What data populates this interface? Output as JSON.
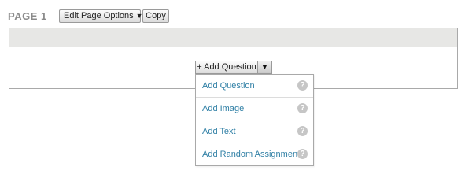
{
  "page": {
    "label": "PAGE 1",
    "edit_options_label": "Edit Page Options",
    "edit_options_caret": "▼",
    "copy_label": "Copy"
  },
  "add_question": {
    "label": "+ Add Question",
    "toggle_caret": "▼"
  },
  "menu": {
    "items": [
      {
        "label": "Add Question",
        "help": "?"
      },
      {
        "label": "Add Image",
        "help": "?"
      },
      {
        "label": "Add Text",
        "help": "?"
      },
      {
        "label": "Add Random Assignment",
        "help": "?"
      }
    ]
  },
  "colors": {
    "link": "#2f7fa5",
    "page_label": "#8a8a8a",
    "header_band": "#e7e7e5",
    "help_icon": "#c6c6c6"
  }
}
